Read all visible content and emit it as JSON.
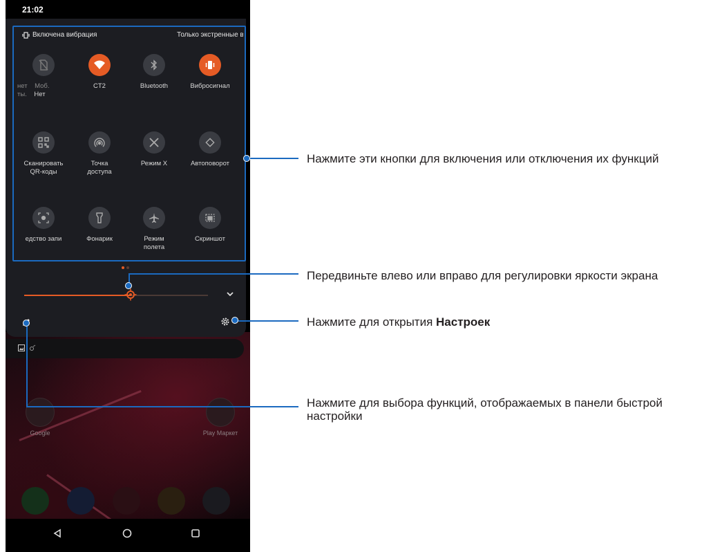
{
  "status": {
    "time": "21:02"
  },
  "shade": {
    "vibration_label": "Включена вибрация",
    "right_label": "Только экстренные вызовы",
    "tiles": [
      {
        "label": "нет  Моб.\nты.   Нет",
        "icon": "no-sim-icon",
        "on": false
      },
      {
        "label": "CT2",
        "icon": "wifi-icon",
        "on": true
      },
      {
        "label": "Bluetooth",
        "icon": "bluetooth-icon",
        "on": false
      },
      {
        "label": "Вибросигнал",
        "icon": "vibrate-icon",
        "on": true
      },
      {
        "label": "Сканировать\nQR-коды",
        "icon": "qr-code-icon",
        "on": false
      },
      {
        "label": "Точка\nдоступа",
        "icon": "hotspot-icon",
        "on": false
      },
      {
        "label": "Режим X",
        "icon": "x-mode-icon",
        "on": false
      },
      {
        "label": "Автоповорот",
        "icon": "auto-rotate-icon",
        "on": false
      },
      {
        "label": "едство запи",
        "icon": "screen-record-icon",
        "on": false
      },
      {
        "label": "Фонарик",
        "icon": "flashlight-icon",
        "on": false
      },
      {
        "label": "Режим\nполета",
        "icon": "airplane-icon",
        "on": false
      },
      {
        "label": "Скриншот",
        "icon": "screenshot-icon",
        "on": false
      }
    ],
    "brightness": 0.58
  },
  "home": {
    "apps": [
      {
        "label": "Google"
      },
      {
        "label": "Play Маркет"
      }
    ]
  },
  "annotations": {
    "buttons": "Нажмите эти кнопки для включения или отключения их функций",
    "brightness": "Передвиньте влево или вправо для регулировки яркости экрана",
    "settings_prefix": "Нажмите для открытия ",
    "settings_bold": "Настроек",
    "edit_line1": "Нажмите для выбора функций, отображаемых в панели быстрой",
    "edit_line2": "настройки"
  },
  "colors": {
    "accent": "#e55b25",
    "callout": "#1b6ac0",
    "shade": "#1c1d22"
  }
}
